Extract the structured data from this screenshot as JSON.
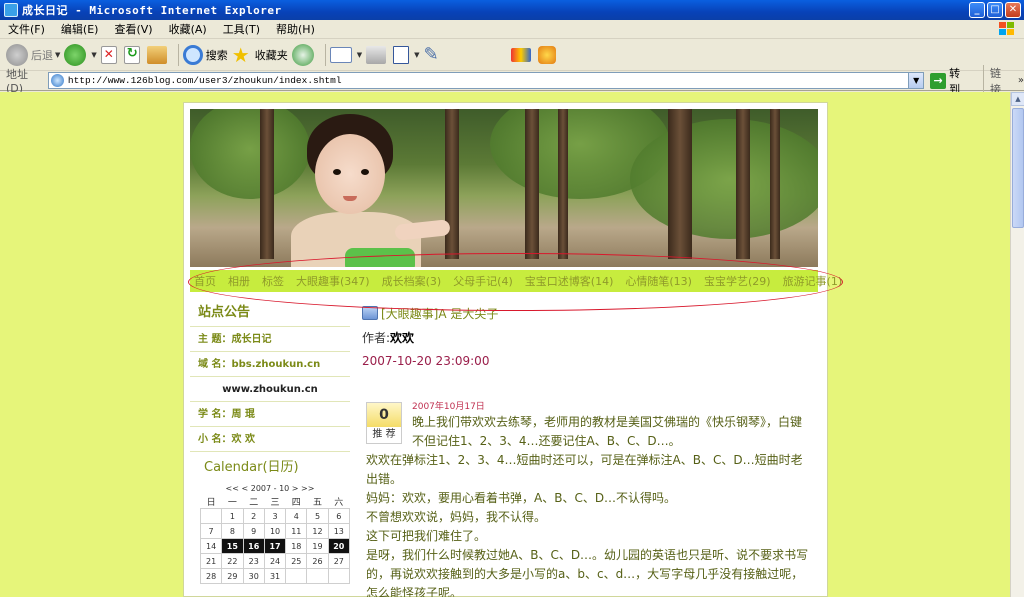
{
  "window": {
    "title": "成长日记 - Microsoft Internet Explorer",
    "buttons": {
      "minimize": "_",
      "maximize": "□",
      "close": "✕"
    }
  },
  "menu": [
    "文件(F)",
    "编辑(E)",
    "查看(V)",
    "收藏(A)",
    "工具(T)",
    "帮助(H)"
  ],
  "toolbar": {
    "back": "后退",
    "search": "搜索",
    "favorites": "收藏夹"
  },
  "address": {
    "label": "地址(D)",
    "url": "http://www.126blog.com/user3/zhoukun/index.shtml",
    "go": "转到",
    "links": "链接",
    "links_more": "»"
  },
  "nav": [
    "首页",
    "相册",
    "标签",
    "大眼趣事(347)",
    "成长档案(3)",
    "父母手记(4)",
    "宝宝口述博客(14)",
    "心情随笔(13)",
    "宝宝学艺(29)",
    "旅游记事(1)"
  ],
  "sidebar": {
    "notice_title": "站点公告",
    "rows": [
      "主  题：成长日记",
      "域  名：bbs.zhoukun.cn",
      "www.zhoukun.cn",
      "学  名：周  琨",
      "小  名：欢  欢"
    ]
  },
  "calendar": {
    "title": "Calendar(日历)",
    "nav": "<< < 2007 - 10 > >>",
    "weekdays": [
      "日",
      "一",
      "二",
      "三",
      "四",
      "五",
      "六"
    ],
    "weeks": [
      [
        "",
        "1",
        "2",
        "3",
        "4",
        "5",
        "6"
      ],
      [
        "7",
        "8",
        "9",
        "10",
        "11",
        "12",
        "13"
      ],
      [
        "14",
        "15",
        "16",
        "17",
        "18",
        "19",
        "20"
      ],
      [
        "21",
        "22",
        "23",
        "24",
        "25",
        "26",
        "27"
      ],
      [
        "28",
        "29",
        "30",
        "31",
        "",
        "",
        ""
      ]
    ],
    "highlighted": [
      "15",
      "16",
      "17",
      "20"
    ]
  },
  "post": {
    "title": "[大眼趣事]A 是大尖子",
    "author_label": "作者:",
    "author": "欢欢",
    "date": "2007-10-20 23:09:00",
    "votes": "0",
    "vote_label": "推 荐",
    "diary_date": "2007年10月17日",
    "first_paragraph": "晚上我们带欢欢去练琴，老师用的教材是美国艾佛瑞的《快乐钢琴》，白键不但记住1、2、3、4…还要记住A、B、C、D…。",
    "paragraphs": [
      "欢欢在弹标注1、2、3、4…短曲时还可以，可是在弹标注A、B、C、D…短曲时老出错。",
      "妈妈：欢欢，要用心看着书弹，A、B、C、D…不认得吗。",
      "不曾想欢欢说，妈妈，我不认得。",
      "这下可把我们难住了。",
      "是呀，我们什么时候教过她A、B、C、D…。幼儿园的英语也只是听、说不要求书写的，再说欢欢接触到的大多是小写的a、b、c、d…，大写字母几乎没有接触过呢，怎么能怪孩子呢。"
    ]
  },
  "colors": {
    "page_background": "#E6F57A",
    "nav_bar": "#C7EC3E",
    "accent_text": "#7B8A17",
    "annotation_circle": "#D8182C"
  }
}
